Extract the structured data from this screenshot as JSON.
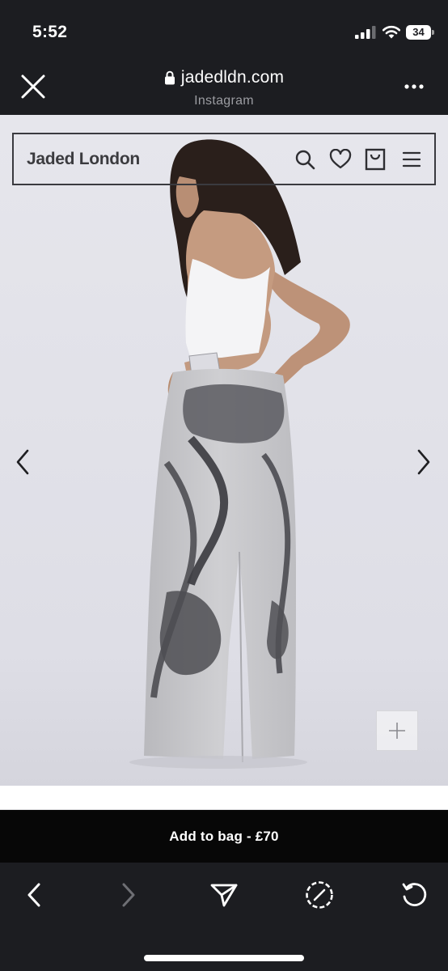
{
  "status_bar": {
    "time": "5:52",
    "battery_level": "34"
  },
  "browser": {
    "url": "jadedldn.com",
    "source": "Instagram",
    "icons": [
      "close-icon",
      "lock-icon",
      "more-icon"
    ]
  },
  "site": {
    "logo": "Jaded London",
    "header_icons": [
      "search-icon",
      "heart-icon",
      "bag-icon",
      "menu-icon"
    ]
  },
  "product": {
    "add_to_bag_label": "Add to bag - £70",
    "gallery_icons": [
      "chevron-left-icon",
      "chevron-right-icon",
      "plus-icon"
    ]
  },
  "toolbar": {
    "icons": [
      "back-icon",
      "forward-icon",
      "share-icon",
      "safari-icon",
      "reload-icon"
    ]
  },
  "colors": {
    "chrome_background": "#1c1d21",
    "button_black": "#070707",
    "photo_backdrop": "#e4e4ea"
  }
}
